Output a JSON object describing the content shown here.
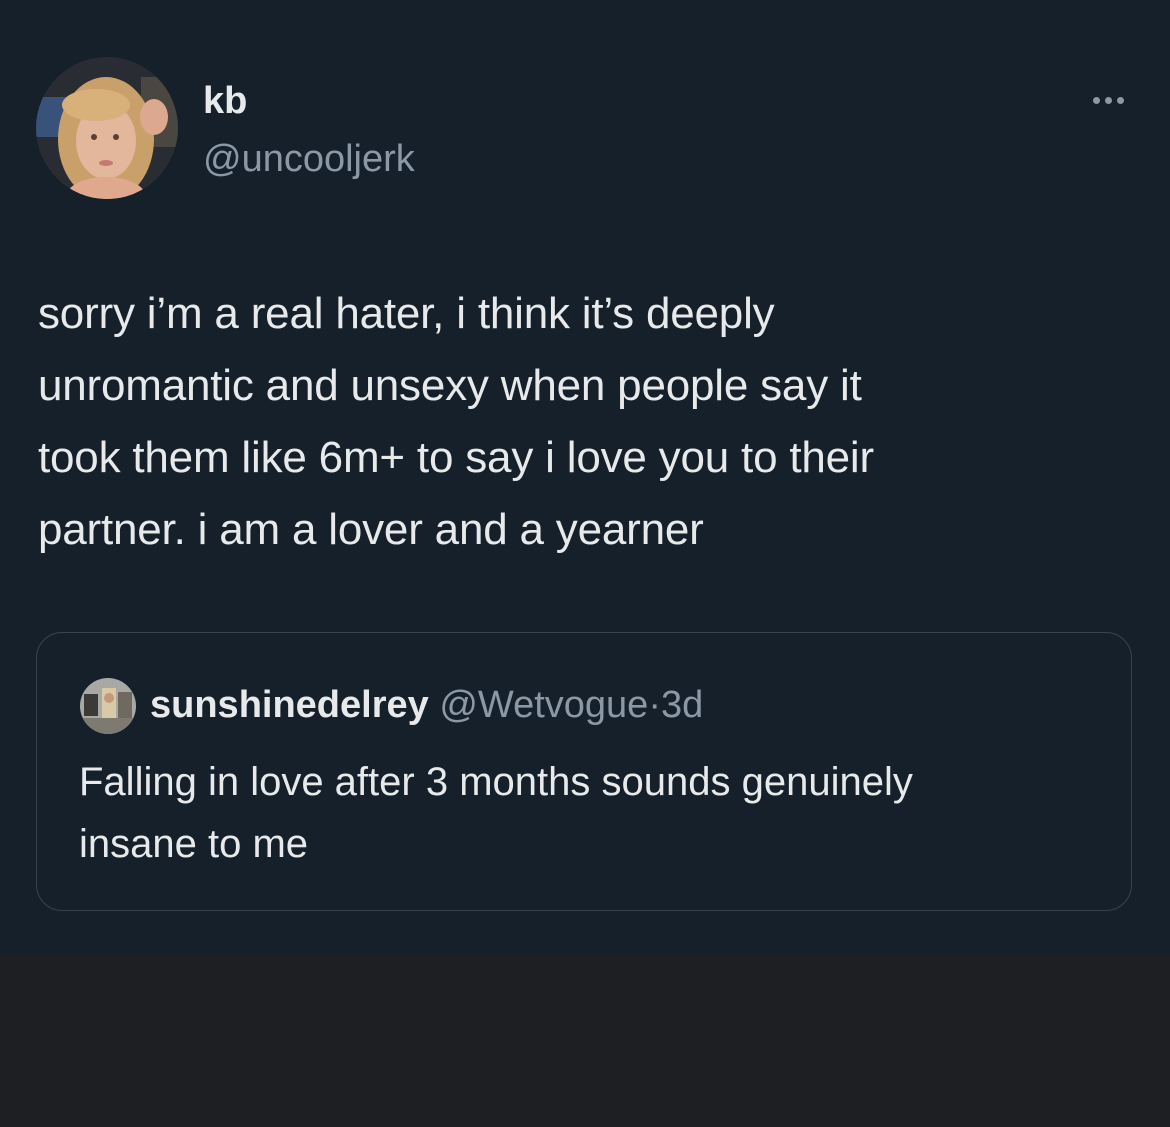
{
  "tweet": {
    "author": {
      "display_name": "kb",
      "handle": "@uncooljerk",
      "avatar_icon": "profile-photo"
    },
    "more_icon": "more-horizontal-icon",
    "text": "sorry i’m a real hater, i think it’s deeply\nunromantic and unsexy when people say it\ntook them like 6m+ to say i love you to their\npartner. i am a lover and a yearner"
  },
  "quote": {
    "author": {
      "display_name": "sunshinedelrey",
      "handle": "@Wetvogue",
      "separator": "·",
      "time": "3d",
      "avatar_icon": "profile-photo"
    },
    "text": "Falling in love after 3 months sounds genuinely\ninsane to me"
  },
  "colors": {
    "background": "#15202b",
    "outer_background": "#1e1f22",
    "primary_text": "#e7e9ea",
    "secondary_text": "#8b98a5",
    "border": "#38444d"
  }
}
